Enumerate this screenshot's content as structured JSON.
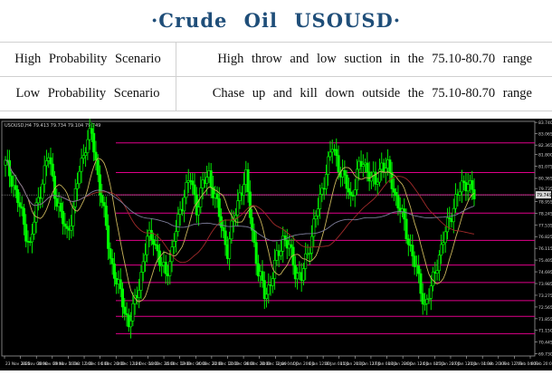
{
  "header": {
    "title": "·Crude  Oil  USOUSD·"
  },
  "scenarios": [
    {
      "label": "High Probability Scenario",
      "text": "High throw and low suction in the 75.10-80.70 range"
    },
    {
      "label": "Low Probability Scenario",
      "text": "Chase up and kill down outside the 75.10-80.70 range"
    }
  ],
  "chart": {
    "info": "USOUSD,H4  79.413 79.734 79.104 79.749",
    "price_tag": "79.749",
    "colors": {
      "bg": "#000000",
      "bull": "#00ff00",
      "hline": "#e0008a",
      "ma1": "#c8b45a",
      "ma2": "#a02a2a",
      "ma3": "#7d7d9a",
      "grid": "#ffffff"
    }
  },
  "chart_data": {
    "type": "candlestick",
    "symbol": "USOUSD",
    "timeframe": "H4",
    "ylim": [
      69.6,
      83.8
    ],
    "y_ticks": [
      "83.740",
      "83.065",
      "82.365",
      "81.800",
      "81.075",
      "80.365",
      "79.735",
      "78.955",
      "78.245",
      "77.535",
      "76.825",
      "76.115",
      "75.405",
      "74.695",
      "73.985",
      "73.275",
      "72.565",
      "71.855",
      "71.150",
      "70.445",
      "69.730"
    ],
    "x_ticks": [
      "23 Nov 2022",
      "24 Nov 00:00",
      "28 Nov 00:00",
      "29 Nov 16:00",
      "1 Dec 12:00",
      "5 Dec 04:00",
      "6 Dec 20:00",
      "8 Dec 12:00",
      "12 Dec 04:00",
      "13 Dec 20:00",
      "15 Dec 12:00",
      "19 Dec 04:00",
      "20 Dec 20:00",
      "22 Dec 12:00",
      "26 Dec 04:00",
      "28 Dec 20:00",
      "30 Dec 12:00",
      "3 Jan 04:00",
      "4 Jan 20:00",
      "6 Jan 12:00",
      "10 Jan 04:00",
      "11 Jan 20:00",
      "13 Jan 12:00",
      "17 Jan 04:00",
      "18 Jan 20:00",
      "20 Jan 12:00",
      "24 Jan 04:00",
      "25 Jan 20:00",
      "27 Jan 12:00",
      "31 Jan 04:00",
      "1 Feb 20:00",
      "3 Feb 12:00",
      "7 Feb 04:00",
      "8 Feb 20:00"
    ],
    "horizontal_levels": [
      82.5,
      80.7,
      79.35,
      78.25,
      76.6,
      75.1,
      74.05,
      72.95,
      72.0,
      70.95
    ],
    "close_path": [
      81.2,
      80.4,
      79.0,
      77.6,
      76.2,
      78.5,
      80.3,
      81.7,
      79.6,
      78.0,
      77.1,
      78.4,
      80.9,
      82.4,
      83.0,
      80.6,
      78.1,
      75.6,
      74.1,
      72.9,
      71.5,
      72.8,
      74.6,
      76.6,
      76.9,
      75.2,
      74.6,
      75.9,
      77.8,
      79.5,
      80.3,
      78.6,
      79.9,
      80.6,
      79.2,
      77.5,
      76.0,
      77.8,
      79.5,
      80.3,
      77.3,
      74.6,
      73.4,
      74.0,
      75.5,
      76.8,
      76.1,
      74.8,
      74.3,
      75.8,
      77.6,
      79.0,
      80.9,
      82.2,
      81.2,
      80.2,
      79.1,
      80.7,
      81.3,
      80.7,
      79.9,
      81.3,
      80.9,
      79.6,
      78.5,
      77.0,
      75.8,
      74.1,
      72.7,
      73.6,
      75.3,
      76.6,
      77.9,
      79.1,
      79.8,
      80.3,
      79.1
    ]
  }
}
